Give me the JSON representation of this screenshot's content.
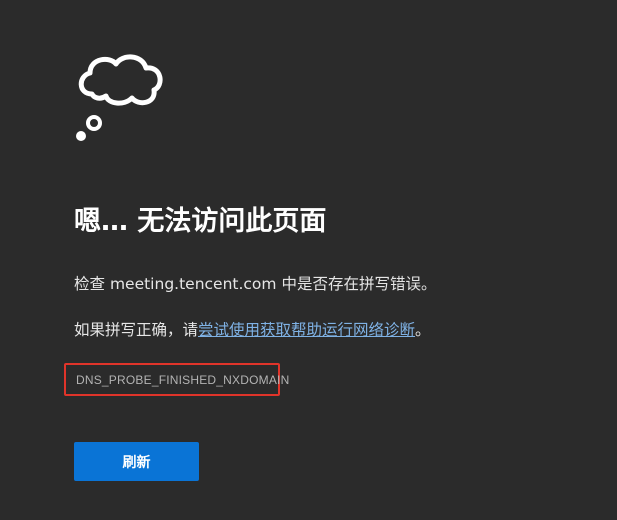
{
  "error_page": {
    "heading": "嗯… 无法访问此页面",
    "check_prefix": "检查 ",
    "domain": "meeting.tencent.com",
    "check_suffix": " 中是否存在拼写错误。",
    "hint_prefix": "如果拼写正确，请",
    "diagnostics_link": "尝试使用获取帮助运行网络诊断",
    "hint_suffix": "。",
    "error_code": "DNS_PROBE_FINISHED_NXDOMAIN",
    "refresh_label": "刷新",
    "icon": "cloud-thought-icon"
  },
  "colors": {
    "background": "#2b2b2b",
    "link": "#7fb2e5",
    "button": "#0a74d6",
    "highlight_box": "#e0342a"
  }
}
